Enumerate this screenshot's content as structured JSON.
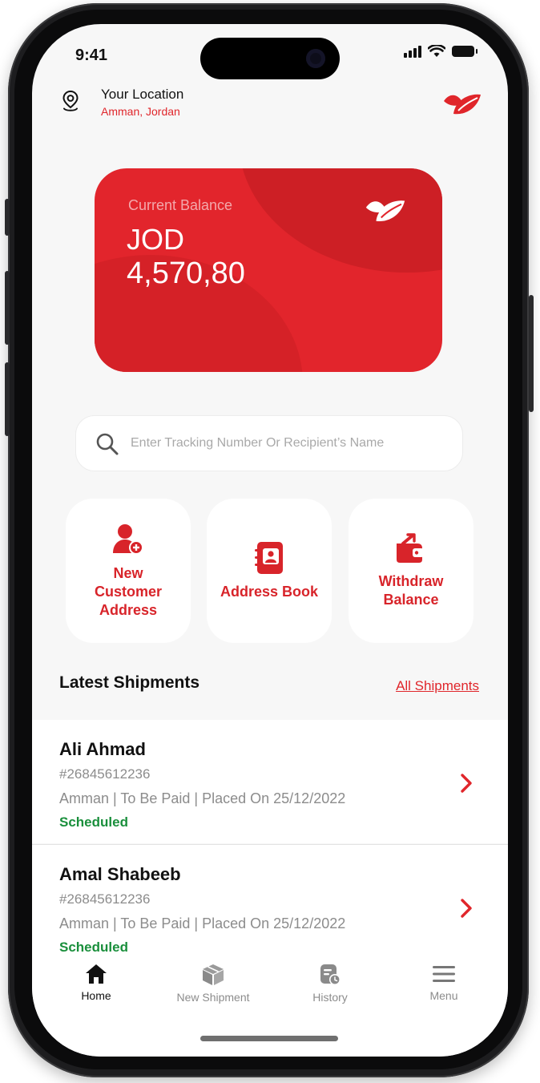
{
  "status_bar": {
    "time": "9:41"
  },
  "header": {
    "location_title": "Your Location",
    "location_value": "Amman, Jordan"
  },
  "balance": {
    "label": "Current Balance",
    "currency": "JOD",
    "amount": "4,570,80"
  },
  "search": {
    "placeholder": "Enter Tracking Number Or Recipient’s Name",
    "value": ""
  },
  "actions": [
    {
      "label": "New Customer Address",
      "icon": "add-user-icon"
    },
    {
      "label": "Address Book",
      "icon": "address-book-icon"
    },
    {
      "label": "Withdraw Balance",
      "icon": "wallet-icon"
    }
  ],
  "shipments_section": {
    "title": "Latest Shipments",
    "all_link": "All Shipments"
  },
  "shipments": [
    {
      "name": "Ali Ahmad",
      "tracking": "#26845612236",
      "meta": "Amman | To Be Paid | Placed On 25/12/2022",
      "status": "Scheduled"
    },
    {
      "name": "Amal Shabeeb",
      "tracking": "#26845612236",
      "meta": "Amman | To Be Paid | Placed On 25/12/2022",
      "status": "Scheduled"
    }
  ],
  "tabs": [
    {
      "label": "Home",
      "icon": "home-icon",
      "active": true
    },
    {
      "label": "New Shipment",
      "icon": "package-icon",
      "active": false
    },
    {
      "label": "History",
      "icon": "history-icon",
      "active": false
    },
    {
      "label": "Menu",
      "icon": "menu-icon",
      "active": false
    }
  ],
  "colors": {
    "brand_red": "#e2252c",
    "status_green": "#1a8f3c",
    "background": "#f7f7f7"
  }
}
